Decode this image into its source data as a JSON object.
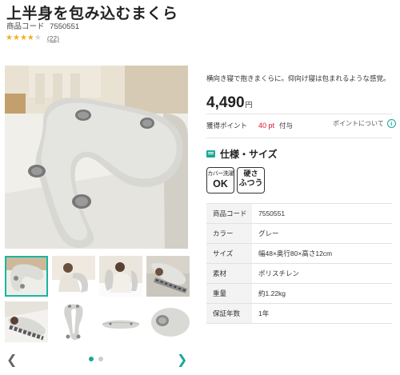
{
  "product": {
    "title": "上半身を包み込むまくら",
    "code_label": "商品コード",
    "code": "7550551",
    "rating": 4,
    "rating_max": 5,
    "review_count": "(22)",
    "catch_copy": "横向き寝で抱きまくらに。仰向け寝は包まれるような感覚。",
    "price": "4,490",
    "currency": "円"
  },
  "points": {
    "label": "獲得ポイント",
    "value": "40 pt",
    "suffix": "付与",
    "about_label": "ポイントについて",
    "about_icon": "info-icon",
    "accent_color": "#d9152d"
  },
  "specs": {
    "title": "仕様・サイズ",
    "icon": "spec-list-icon",
    "badges": [
      {
        "line1": "カバー洗濯",
        "line2": "OK"
      },
      {
        "line1": "硬さ",
        "line2": "ふつう"
      }
    ],
    "rows": [
      {
        "key": "商品コード",
        "value": "7550551"
      },
      {
        "key": "カラー",
        "value": "グレー"
      },
      {
        "key": "サイズ",
        "value": "幅48×奥行80×高さ12cm"
      },
      {
        "key": "素材",
        "value": "ポリスチレン"
      },
      {
        "key": "重量",
        "value": "約1.22kg"
      },
      {
        "key": "保証年数",
        "value": "1年"
      }
    ]
  },
  "gallery": {
    "current_page": 1,
    "page_count": 2,
    "prev_icon": "chevron-left-icon",
    "next_icon": "chevron-right-icon",
    "accent_color": "#19a897"
  }
}
